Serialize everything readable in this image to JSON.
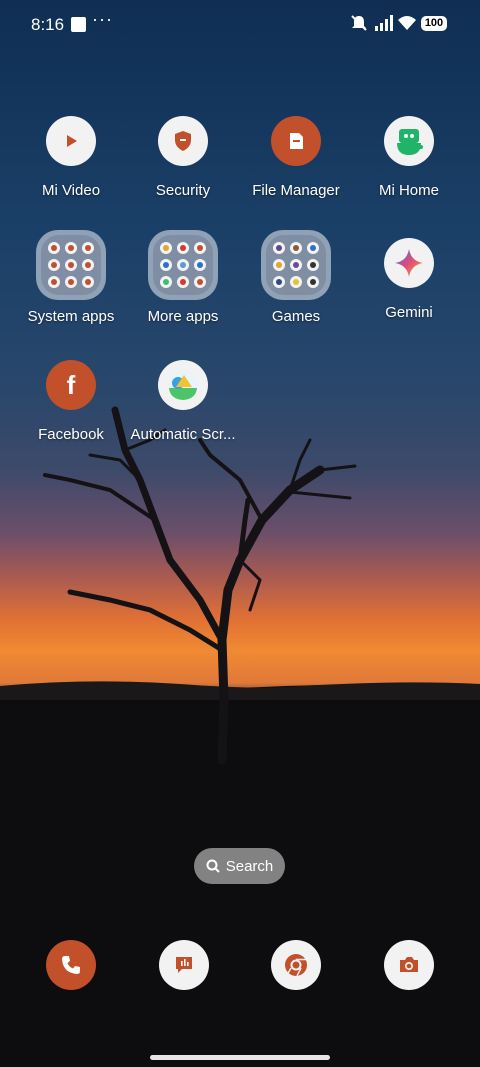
{
  "status_bar": {
    "time": "8:16",
    "more": "···",
    "battery": "100"
  },
  "apps": [
    {
      "label": "Mi Video",
      "icon": "play-icon"
    },
    {
      "label": "Security",
      "icon": "shield-icon"
    },
    {
      "label": "File Manager",
      "icon": "folder-file-icon"
    },
    {
      "label": "Mi Home",
      "icon": "mi-home-icon"
    },
    {
      "label": "System apps",
      "icon": "folder-icon"
    },
    {
      "label": "More apps",
      "icon": "folder-icon"
    },
    {
      "label": "Games",
      "icon": "folder-icon"
    },
    {
      "label": "Gemini",
      "icon": "gemini-star-icon"
    },
    {
      "label": "Facebook",
      "icon": "facebook-icon"
    },
    {
      "label": "Automatic Scr...",
      "icon": "automatic-screen-icon"
    }
  ],
  "search": {
    "label": "Search"
  },
  "dock": [
    {
      "icon": "phone-icon"
    },
    {
      "icon": "messages-icon"
    },
    {
      "icon": "chrome-icon"
    },
    {
      "icon": "camera-icon"
    }
  ],
  "colors": {
    "accent": "#c2502a",
    "icon_bg": "#f2f2f2"
  }
}
